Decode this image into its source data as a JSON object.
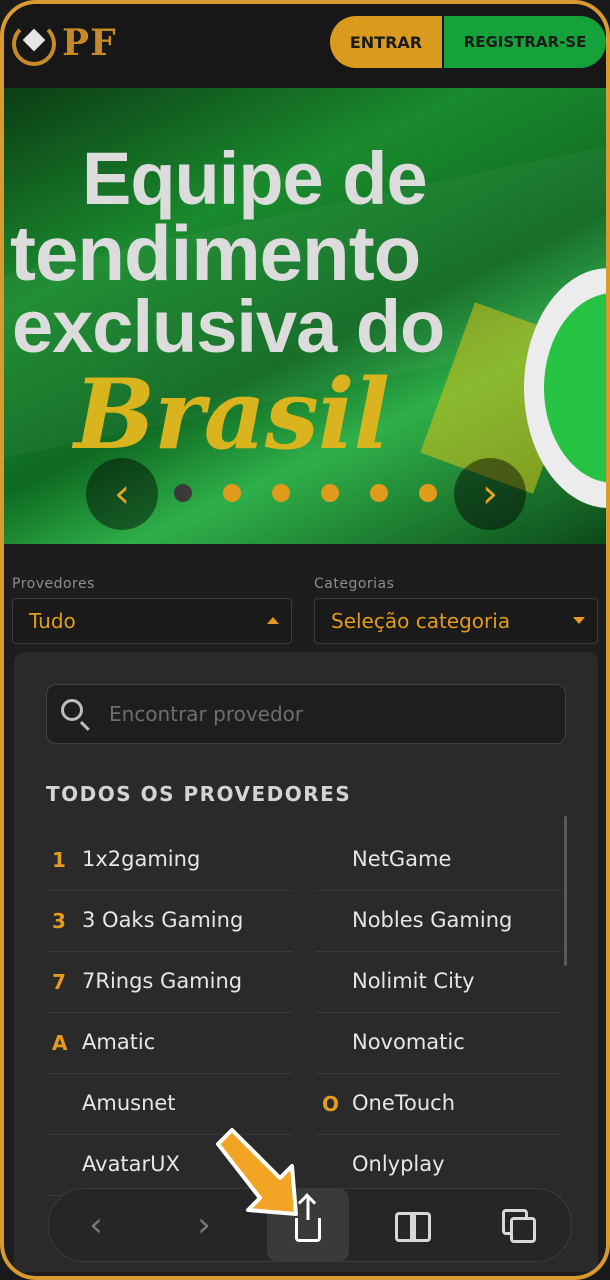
{
  "header": {
    "logo_text": "PF",
    "login_label": "ENTRAR",
    "register_label": "REGISTRAR-SE"
  },
  "banner": {
    "line1": "Equipe de",
    "line2": "tendimento",
    "line3": "exclusiva do",
    "line4": "Brasil",
    "slide_count": 6,
    "active_slide": 1,
    "prev_icon": "chevron-left-icon",
    "next_icon": "chevron-right-icon"
  },
  "filters": {
    "providers_label": "Provedores",
    "providers_value": "Tudo",
    "categories_label": "Categorias",
    "categories_value": "Seleção categoria"
  },
  "providers_panel": {
    "search_placeholder": "Encontrar provedor",
    "title": "TODOS OS PROVEDORES",
    "left_column": [
      {
        "letter": "1",
        "name": "1x2gaming"
      },
      {
        "letter": "3",
        "name": "3 Oaks Gaming"
      },
      {
        "letter": "7",
        "name": "7Rings Gaming"
      },
      {
        "letter": "A",
        "name": "Amatic"
      },
      {
        "letter": "",
        "name": "Amusnet"
      },
      {
        "letter": "",
        "name": "AvatarUX"
      }
    ],
    "right_column": [
      {
        "letter": "",
        "name": "NetGame"
      },
      {
        "letter": "",
        "name": "Nobles Gaming"
      },
      {
        "letter": "",
        "name": "Nolimit City"
      },
      {
        "letter": "",
        "name": "Novomatic"
      },
      {
        "letter": "O",
        "name": "OneTouch"
      },
      {
        "letter": "",
        "name": "Onlyplay"
      }
    ]
  },
  "browser_toolbar": {
    "items": [
      "back-icon",
      "forward-icon",
      "share-icon",
      "bookmarks-icon",
      "tabs-icon"
    ],
    "highlighted": "share-icon"
  },
  "colors": {
    "accent": "#e39b1e",
    "register": "#16a23a",
    "frame": "#d99a2e",
    "background": "#1d1d1d",
    "panel": "#2a2a2a"
  }
}
